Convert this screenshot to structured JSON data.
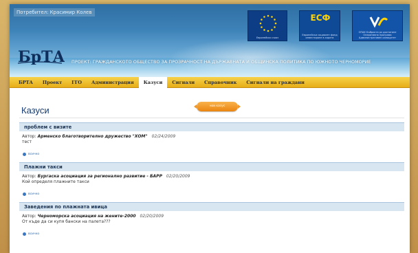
{
  "header": {
    "user_line": "Потребител: Красимир Колев",
    "project_title": "ПРОЕКТ: ГРАЖДАНСКОТО ОБЩЕСТВО ЗА ПРОЗРАЧНОСТ НА ДЪРЖАВНАТА И ОБЩИНСКА ПОЛИТИКА ПО ЮЖНОТО ЧЕРНОМОРИЕ",
    "brand_text": "БрТА",
    "logos": {
      "eu_caption": "Европейски съюз",
      "esf_mark": "ЕСФ",
      "esf_caption": "Европейски социален фонд инвестиране в хората",
      "op_caption": "ОПАК Бъбриста рх достигане Оперативна програма Административен капацитет"
    }
  },
  "nav": {
    "items": [
      {
        "label": "БРТА",
        "active": false
      },
      {
        "label": "Проект",
        "active": false
      },
      {
        "label": "ГГО",
        "active": false
      },
      {
        "label": "Администрация",
        "active": false
      },
      {
        "label": "Казуси",
        "active": true
      },
      {
        "label": "Сигнали",
        "active": false
      },
      {
        "label": "Справочник",
        "active": false
      },
      {
        "label": "Сигнали на граждани",
        "active": false
      }
    ]
  },
  "main": {
    "title": "Казуси",
    "new_case_label": "нов казус",
    "author_prefix": "Автор:",
    "more_label": "всичко",
    "cases": [
      {
        "title": "проблем с визите",
        "author": "Арменско благотворително дружество \"ХОМ\"",
        "date": "02/24/2009",
        "description": "тест"
      },
      {
        "title": "Плажни такси",
        "author": "Бургаска асоциация за регионално развитие - БАРР",
        "date": "02/20/2009",
        "description": "Кой определя плажните такси"
      },
      {
        "title": "Заведения по плажната ивица",
        "author": "Черноморска асоциация на жените-2000",
        "date": "02/20/2009",
        "description": "От къде да си купя бански на палета???"
      }
    ]
  },
  "colors": {
    "header_blue": "#2f6fa3",
    "nav_yellow": "#f0c030",
    "title_blue": "#143b73",
    "button_orange": "#ea8511",
    "case_header_bg": "#d8e6f2"
  }
}
